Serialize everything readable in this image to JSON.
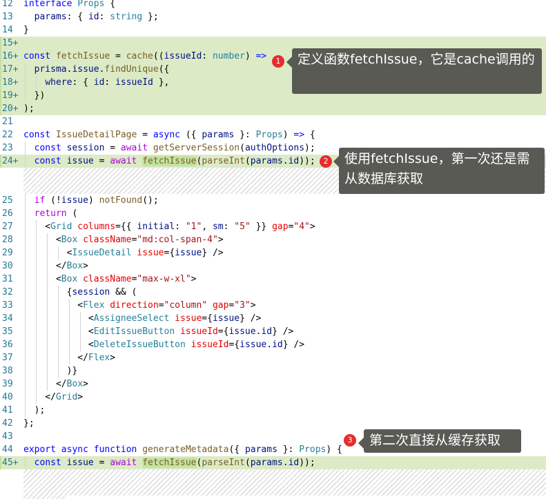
{
  "callouts": [
    {
      "badge": "1",
      "text": "定义函数fetchIssue，它是cache调用的"
    },
    {
      "badge": "2",
      "text": "使用fetchIssue，第一次还是需从数据库获取"
    },
    {
      "badge": "3",
      "text": "第二次直接从缓存获取"
    }
  ],
  "colors": {
    "added_line_bg": "#dcebc6",
    "highlight_bg": "#c3e3a2",
    "callout_bg": "#595a54",
    "badge_red": "#e62d2d",
    "line_number": "#237893"
  },
  "lines": [
    {
      "n": "12",
      "added": false,
      "tokens": [
        [
          "kw",
          "interface"
        ],
        [
          "pn",
          " "
        ],
        [
          "tp",
          "Props"
        ],
        [
          "pn",
          " {"
        ]
      ]
    },
    {
      "n": "13",
      "added": false,
      "tokens": [
        [
          "pn",
          "  "
        ],
        [
          "vr",
          "params"
        ],
        [
          "pn",
          ": { "
        ],
        [
          "vr",
          "id"
        ],
        [
          "pn",
          ": "
        ],
        [
          "tp",
          "string"
        ],
        [
          "pn",
          " };"
        ]
      ]
    },
    {
      "n": "14",
      "added": false,
      "tokens": [
        [
          "pn",
          "}"
        ]
      ]
    },
    {
      "n": "15+",
      "added": true,
      "tokens": []
    },
    {
      "n": "16+",
      "added": true,
      "tokens": [
        [
          "kw",
          "const"
        ],
        [
          "pn",
          " "
        ],
        [
          "fn",
          "fetchIssue"
        ],
        [
          "pn",
          " = "
        ],
        [
          "fn",
          "cache"
        ],
        [
          "pn",
          "(("
        ],
        [
          "vr",
          "issueId"
        ],
        [
          "pn",
          ": "
        ],
        [
          "tp",
          "number"
        ],
        [
          "pn",
          ") "
        ],
        [
          "kw",
          "=>"
        ]
      ]
    },
    {
      "n": "17+",
      "added": true,
      "tokens": [
        [
          "pn",
          "  "
        ],
        [
          "vr",
          "prisma"
        ],
        [
          "pn",
          "."
        ],
        [
          "vr",
          "issue"
        ],
        [
          "pn",
          "."
        ],
        [
          "fn",
          "findUnique"
        ],
        [
          "pn",
          "({"
        ]
      ]
    },
    {
      "n": "18+",
      "added": true,
      "tokens": [
        [
          "pn",
          "    "
        ],
        [
          "vr",
          "where"
        ],
        [
          "pn",
          ": { "
        ],
        [
          "vr",
          "id"
        ],
        [
          "pn",
          ": "
        ],
        [
          "vr",
          "issueId"
        ],
        [
          "pn",
          " },"
        ]
      ]
    },
    {
      "n": "19+",
      "added": true,
      "tokens": [
        [
          "pn",
          "  })"
        ]
      ]
    },
    {
      "n": "20+",
      "added": true,
      "tokens": [
        [
          "pn",
          ");"
        ]
      ]
    },
    {
      "n": "21",
      "added": false,
      "tokens": []
    },
    {
      "n": "22",
      "added": false,
      "tokens": [
        [
          "kw",
          "const"
        ],
        [
          "pn",
          " "
        ],
        [
          "fn",
          "IssueDetailPage"
        ],
        [
          "pn",
          " = "
        ],
        [
          "kw",
          "async"
        ],
        [
          "pn",
          " ({ "
        ],
        [
          "vr",
          "params"
        ],
        [
          "pn",
          " }: "
        ],
        [
          "tp",
          "Props"
        ],
        [
          "pn",
          ") "
        ],
        [
          "kw",
          "=>"
        ],
        [
          "pn",
          " {"
        ]
      ]
    },
    {
      "n": "23",
      "added": false,
      "tokens": [
        [
          "pn",
          "  "
        ],
        [
          "kw",
          "const"
        ],
        [
          "pn",
          " "
        ],
        [
          "vr",
          "session"
        ],
        [
          "pn",
          " = "
        ],
        [
          "ctl",
          "await"
        ],
        [
          "pn",
          " "
        ],
        [
          "fn",
          "getServerSession"
        ],
        [
          "pn",
          "("
        ],
        [
          "vr",
          "authOptions"
        ],
        [
          "pn",
          ");"
        ]
      ]
    },
    {
      "n": "24+",
      "added": true,
      "tokens": [
        [
          "pn",
          "  "
        ],
        [
          "kw",
          "const"
        ],
        [
          "pn",
          " "
        ],
        [
          "vr",
          "issue"
        ],
        [
          "pn",
          " = "
        ],
        [
          "ctl",
          "await"
        ],
        [
          "pn",
          " "
        ],
        [
          "hlfn",
          "fetchIssue"
        ],
        [
          "pn",
          "("
        ],
        [
          "fn",
          "parseInt"
        ],
        [
          "pn",
          "("
        ],
        [
          "vr",
          "params"
        ],
        [
          "pn",
          "."
        ],
        [
          "vr",
          "id"
        ],
        [
          "pn",
          "))"
        ],
        [
          "pn",
          ";"
        ]
      ]
    },
    {
      "n": "25",
      "added": false,
      "tokens": [
        [
          "pn",
          "  "
        ],
        [
          "ctl",
          "if"
        ],
        [
          "pn",
          " (!"
        ],
        [
          "vr",
          "issue"
        ],
        [
          "pn",
          ") "
        ],
        [
          "fn",
          "notFound"
        ],
        [
          "pn",
          "();"
        ]
      ]
    },
    {
      "n": "26",
      "added": false,
      "tokens": [
        [
          "pn",
          "  "
        ],
        [
          "ctl",
          "return"
        ],
        [
          "pn",
          " ("
        ]
      ]
    },
    {
      "n": "27",
      "added": false,
      "tokens": [
        [
          "pn",
          "    <"
        ],
        [
          "tp",
          "Grid"
        ],
        [
          "pn",
          " "
        ],
        [
          "at",
          "columns"
        ],
        [
          "pn",
          "={{ "
        ],
        [
          "vr",
          "initial"
        ],
        [
          "pn",
          ": "
        ],
        [
          "st",
          "\"1\""
        ],
        [
          "pn",
          ", "
        ],
        [
          "vr",
          "sm"
        ],
        [
          "pn",
          ": "
        ],
        [
          "st",
          "\"5\""
        ],
        [
          "pn",
          " }} "
        ],
        [
          "at",
          "gap"
        ],
        [
          "pn",
          "="
        ],
        [
          "st",
          "\"4\""
        ],
        [
          "pn",
          ">"
        ]
      ]
    },
    {
      "n": "28",
      "added": false,
      "tokens": [
        [
          "pn",
          "      <"
        ],
        [
          "tp",
          "Box"
        ],
        [
          "pn",
          " "
        ],
        [
          "at",
          "className"
        ],
        [
          "pn",
          "="
        ],
        [
          "st",
          "\"md:col-span-4\""
        ],
        [
          "pn",
          ">"
        ]
      ]
    },
    {
      "n": "29",
      "added": false,
      "tokens": [
        [
          "pn",
          "        <"
        ],
        [
          "tp",
          "IssueDetail"
        ],
        [
          "pn",
          " "
        ],
        [
          "at",
          "issue"
        ],
        [
          "pn",
          "={"
        ],
        [
          "vr",
          "issue"
        ],
        [
          "pn",
          "} />"
        ]
      ]
    },
    {
      "n": "30",
      "added": false,
      "tokens": [
        [
          "pn",
          "      </"
        ],
        [
          "tp",
          "Box"
        ],
        [
          "pn",
          ">"
        ]
      ]
    },
    {
      "n": "31",
      "added": false,
      "tokens": [
        [
          "pn",
          "      <"
        ],
        [
          "tp",
          "Box"
        ],
        [
          "pn",
          " "
        ],
        [
          "at",
          "className"
        ],
        [
          "pn",
          "="
        ],
        [
          "st",
          "\"max-w-xl\""
        ],
        [
          "pn",
          ">"
        ]
      ]
    },
    {
      "n": "32",
      "added": false,
      "tokens": [
        [
          "pn",
          "        {"
        ],
        [
          "vr",
          "session"
        ],
        [
          "pn",
          " && ("
        ]
      ]
    },
    {
      "n": "33",
      "added": false,
      "tokens": [
        [
          "pn",
          "          <"
        ],
        [
          "tp",
          "Flex"
        ],
        [
          "pn",
          " "
        ],
        [
          "at",
          "direction"
        ],
        [
          "pn",
          "="
        ],
        [
          "st",
          "\"column\""
        ],
        [
          "pn",
          " "
        ],
        [
          "at",
          "gap"
        ],
        [
          "pn",
          "="
        ],
        [
          "st",
          "\"3\""
        ],
        [
          "pn",
          ">"
        ]
      ]
    },
    {
      "n": "34",
      "added": false,
      "tokens": [
        [
          "pn",
          "            <"
        ],
        [
          "tp",
          "AssigneeSelect"
        ],
        [
          "pn",
          " "
        ],
        [
          "at",
          "issue"
        ],
        [
          "pn",
          "={"
        ],
        [
          "vr",
          "issue"
        ],
        [
          "pn",
          "} />"
        ]
      ]
    },
    {
      "n": "35",
      "added": false,
      "tokens": [
        [
          "pn",
          "            <"
        ],
        [
          "tp",
          "EditIssueButton"
        ],
        [
          "pn",
          " "
        ],
        [
          "at",
          "issueId"
        ],
        [
          "pn",
          "={"
        ],
        [
          "vr",
          "issue"
        ],
        [
          "pn",
          "."
        ],
        [
          "vr",
          "id"
        ],
        [
          "pn",
          "} />"
        ]
      ]
    },
    {
      "n": "36",
      "added": false,
      "tokens": [
        [
          "pn",
          "            <"
        ],
        [
          "tp",
          "DeleteIssueButton"
        ],
        [
          "pn",
          " "
        ],
        [
          "at",
          "issueId"
        ],
        [
          "pn",
          "={"
        ],
        [
          "vr",
          "issue"
        ],
        [
          "pn",
          "."
        ],
        [
          "vr",
          "id"
        ],
        [
          "pn",
          "} />"
        ]
      ]
    },
    {
      "n": "37",
      "added": false,
      "tokens": [
        [
          "pn",
          "          </"
        ],
        [
          "tp",
          "Flex"
        ],
        [
          "pn",
          ">"
        ]
      ]
    },
    {
      "n": "38",
      "added": false,
      "tokens": [
        [
          "pn",
          "        )}"
        ]
      ]
    },
    {
      "n": "39",
      "added": false,
      "tokens": [
        [
          "pn",
          "      </"
        ],
        [
          "tp",
          "Box"
        ],
        [
          "pn",
          ">"
        ]
      ]
    },
    {
      "n": "40",
      "added": false,
      "tokens": [
        [
          "pn",
          "    </"
        ],
        [
          "tp",
          "Grid"
        ],
        [
          "pn",
          ">"
        ]
      ]
    },
    {
      "n": "41",
      "added": false,
      "tokens": [
        [
          "pn",
          "  );"
        ]
      ]
    },
    {
      "n": "42",
      "added": false,
      "tokens": [
        [
          "pn",
          "};"
        ]
      ]
    },
    {
      "n": "43",
      "added": false,
      "tokens": []
    },
    {
      "n": "44",
      "added": false,
      "tokens": [
        [
          "kw",
          "export"
        ],
        [
          "pn",
          " "
        ],
        [
          "kw",
          "async"
        ],
        [
          "pn",
          " "
        ],
        [
          "kw",
          "function"
        ],
        [
          "pn",
          " "
        ],
        [
          "fn",
          "generateMetadata"
        ],
        [
          "pn",
          "({ "
        ],
        [
          "vr",
          "params"
        ],
        [
          "pn",
          " }: "
        ],
        [
          "tp",
          "Props"
        ],
        [
          "pn",
          ") {"
        ]
      ]
    },
    {
      "n": "45+",
      "added": true,
      "tokens": [
        [
          "pn",
          "  "
        ],
        [
          "kw",
          "const"
        ],
        [
          "pn",
          " "
        ],
        [
          "vr",
          "issue"
        ],
        [
          "pn",
          " = "
        ],
        [
          "ctl",
          "await"
        ],
        [
          "pn",
          " "
        ],
        [
          "hlfn",
          "fetchIssue"
        ],
        [
          "pn",
          "("
        ],
        [
          "fn",
          "parseInt"
        ],
        [
          "pn",
          "("
        ],
        [
          "vr",
          "params"
        ],
        [
          "pn",
          "."
        ],
        [
          "vr",
          "id"
        ],
        [
          "pn",
          "))"
        ],
        [
          "pn",
          ";"
        ]
      ]
    }
  ]
}
